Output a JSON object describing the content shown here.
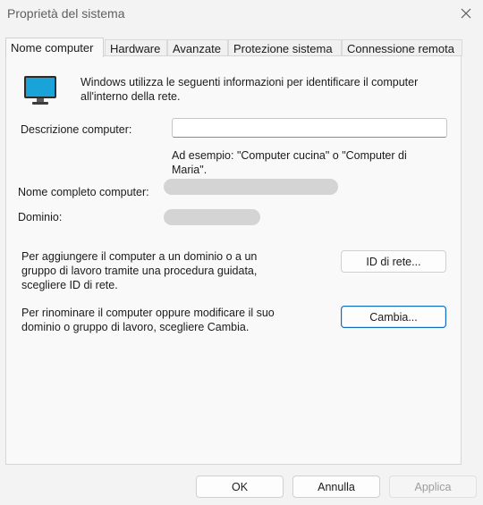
{
  "window": {
    "title": "Proprietà del sistema"
  },
  "tabs": [
    {
      "label": "Nome computer",
      "active": true
    },
    {
      "label": "Hardware"
    },
    {
      "label": "Avanzate"
    },
    {
      "label": "Protezione sistema"
    },
    {
      "label": "Connessione remota"
    }
  ],
  "intro": {
    "icon": "monitor-icon",
    "text_line1": "Windows utilizza le seguenti informazioni per identificare il computer",
    "text_line2": "all'interno della rete."
  },
  "form": {
    "description_label": "Descrizione computer:",
    "description_value": "",
    "example_line1": "Ad esempio: \"Computer cucina\" o \"Computer di",
    "example_line2": "Maria\".",
    "full_name_label": "Nome completo computer:",
    "domain_label": "Dominio:"
  },
  "network_id": {
    "text_line1": "Per aggiungere il computer a un dominio o a un",
    "text_line2": "gruppo di lavoro tramite una procedura guidata,",
    "text_line3": "scegliere ID di rete.",
    "button_label": "ID di rete..."
  },
  "rename": {
    "text_line1": "Per rinominare il computer oppure modificare il suo",
    "text_line2": "dominio o gruppo di lavoro, scegliere Cambia.",
    "button_label": "Cambia..."
  },
  "footer": {
    "ok_label": "OK",
    "cancel_label": "Annulla",
    "apply_label": "Applica"
  },
  "colors": {
    "accent": "#0f6cbd",
    "monitor_screen": "#1aa3d9"
  }
}
